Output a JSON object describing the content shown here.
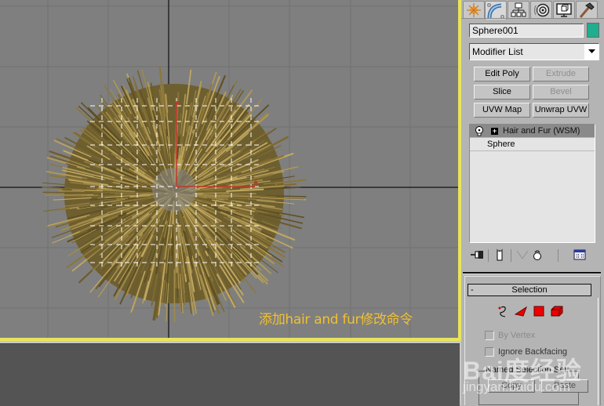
{
  "viewport": {
    "caption": "添加hair and fur修改命令",
    "active_border_color": "#e9e45a",
    "background_color": "#7f7f7f",
    "object": "hair-and-fur-sphere"
  },
  "command_panel": {
    "tabs": [
      {
        "name": "create",
        "icon": "create-icon",
        "active": false
      },
      {
        "name": "modify",
        "icon": "modify-icon",
        "active": true
      },
      {
        "name": "hierarchy",
        "icon": "hierarchy-icon",
        "active": false
      },
      {
        "name": "motion",
        "icon": "motion-icon",
        "active": false
      },
      {
        "name": "display",
        "icon": "display-icon",
        "active": false
      },
      {
        "name": "utilities",
        "icon": "utilities-icon",
        "active": false
      }
    ],
    "object_name": "Sphere001",
    "object_color": "#1fae8e",
    "modifier_list": {
      "selected": "Modifier List"
    },
    "modifier_buttons": [
      {
        "label": "Edit Poly",
        "enabled": true
      },
      {
        "label": "Extrude",
        "enabled": false
      },
      {
        "label": "Slice",
        "enabled": true
      },
      {
        "label": "Bevel",
        "enabled": false
      },
      {
        "label": "UVW Map",
        "enabled": true
      },
      {
        "label": "Unwrap UVW",
        "enabled": true
      }
    ],
    "stack": [
      {
        "label": "Hair and Fur (WSM)",
        "selected": true,
        "expand": "+"
      },
      {
        "label": "Sphere",
        "selected": false
      }
    ],
    "stack_tools": [
      "pin-stack-icon",
      "show-end-result-icon",
      "make-unique-icon",
      "remove-modifier-icon",
      "configure-modifier-sets-icon"
    ],
    "selection_rollout": {
      "title": "Selection",
      "collapse": "-",
      "levels": [
        "guides-icon",
        "face-icon",
        "polygon-icon",
        "element-icon"
      ],
      "by_vertex": {
        "label": "By Vertex",
        "checked": false
      },
      "ignore_backfacing": {
        "label": "Ignore Backfacing",
        "checked": false
      },
      "named_selection_set": {
        "label": "Named Selection Set:",
        "copy": "Copy",
        "paste": "Paste"
      }
    }
  },
  "watermark": {
    "logo": "Bai度经验",
    "url": "jingyan.baidu.com"
  }
}
